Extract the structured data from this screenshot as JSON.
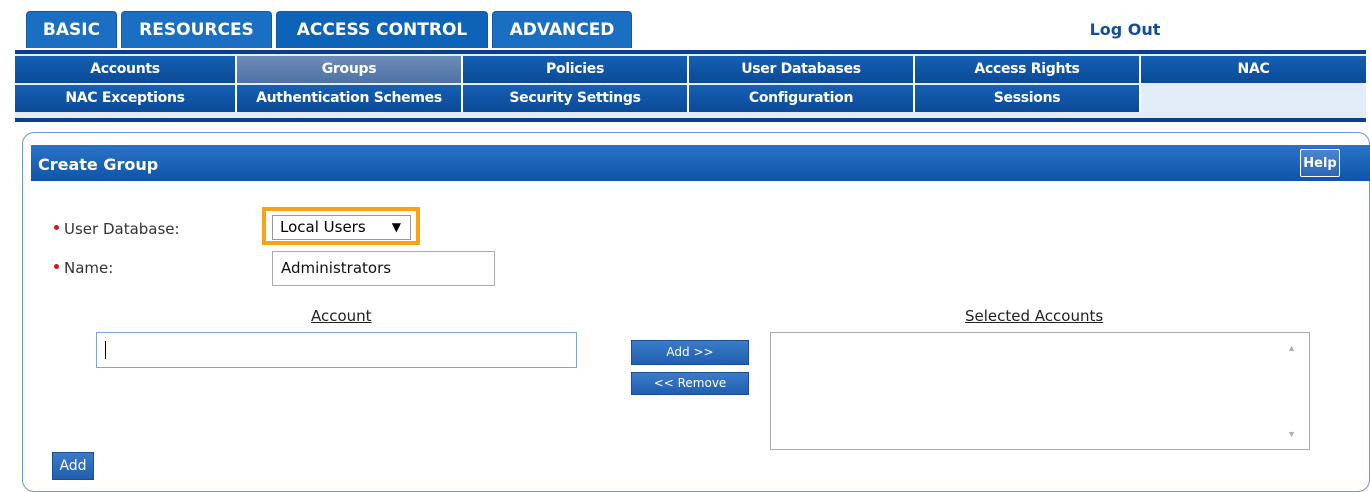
{
  "top_tabs": [
    {
      "label": "BASIC",
      "active": false
    },
    {
      "label": "RESOURCES",
      "active": false
    },
    {
      "label": "ACCESS CONTROL",
      "active": true
    },
    {
      "label": "ADVANCED",
      "active": false
    }
  ],
  "logout_label": "Log Out",
  "subnav": {
    "row1": [
      "Accounts",
      "Groups",
      "Policies",
      "User Databases",
      "Access Rights",
      "NAC"
    ],
    "row2": [
      "NAC Exceptions",
      "Authentication Schemes",
      "Security Settings",
      "Configuration",
      "Sessions"
    ],
    "active": "Groups"
  },
  "panel": {
    "title": "Create Group",
    "help_label": "Help"
  },
  "form": {
    "user_database_label": "User Database:",
    "user_database_value": "Local Users",
    "name_label": "Name:",
    "name_value": "Administrators",
    "account_header": "Account",
    "account_value": "",
    "selected_header": "Selected Accounts",
    "add_arrow_label": "Add >>",
    "remove_label": "<< Remove",
    "add_label": "Add"
  },
  "colors": {
    "tab_blue": "#1a6fc2",
    "nav_blue": "#0b4a97",
    "highlight": "#f4a414",
    "required_dot": "#d21a1a"
  },
  "icons": {
    "dropdown": "triangle-down",
    "scroll_up": "triangle-up",
    "scroll_down": "triangle-down"
  }
}
